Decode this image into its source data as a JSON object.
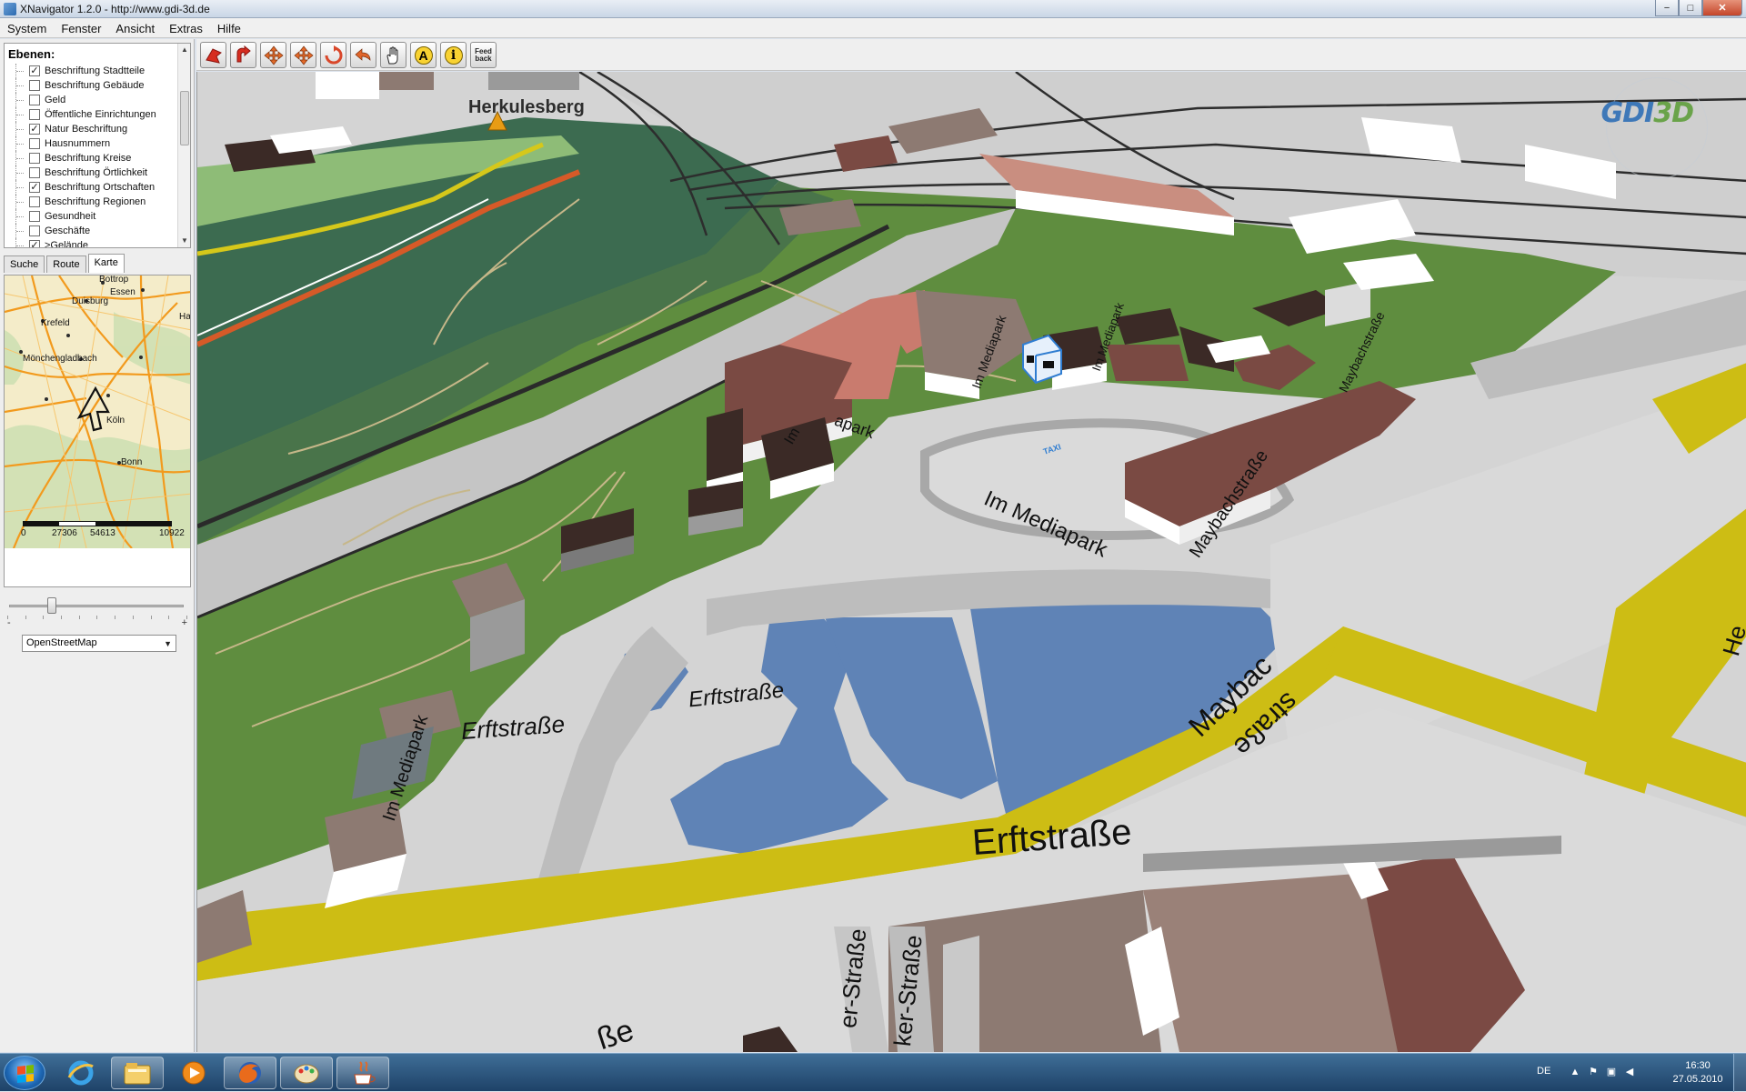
{
  "window": {
    "title": "XNavigator 1.2.0 - http://www.gdi-3d.de",
    "minimize": "−",
    "maximize": "□",
    "close": "✕"
  },
  "menu": [
    "System",
    "Fenster",
    "Ansicht",
    "Extras",
    "Hilfe"
  ],
  "layers": {
    "title": "Ebenen:",
    "items": [
      {
        "label": "Beschriftung Stadtteile",
        "checked": true
      },
      {
        "label": "Beschriftung Gebäude",
        "checked": false
      },
      {
        "label": "Geld",
        "checked": false
      },
      {
        "label": "Öffentliche Einrichtungen",
        "checked": false
      },
      {
        "label": "Natur Beschriftung",
        "checked": true
      },
      {
        "label": "Hausnummern",
        "checked": false
      },
      {
        "label": "Beschriftung Kreise",
        "checked": false
      },
      {
        "label": "Beschriftung Örtlichkeit",
        "checked": false
      },
      {
        "label": "Beschriftung Ortschaften",
        "checked": true
      },
      {
        "label": "Beschriftung Regionen",
        "checked": false
      },
      {
        "label": "Gesundheit",
        "checked": false
      },
      {
        "label": "Geschäfte",
        "checked": false
      },
      {
        "label": ">Gelände",
        "checked": true
      }
    ]
  },
  "tabs": [
    "Suche",
    "Route",
    "Karte"
  ],
  "active_tab": "Karte",
  "minimap": {
    "cities": [
      "Bottrop",
      "Essen",
      "Duisburg",
      "Krefeld",
      "Ha",
      "Mönchengladbach",
      "Köln",
      "Bonn"
    ],
    "scale": [
      "0",
      "27306",
      "54613",
      "10922"
    ]
  },
  "zoom_slider": {
    "minus": "-",
    "plus": "+",
    "value": 0.23
  },
  "map_source": {
    "selected": "OpenStreetMap"
  },
  "toolbar": {
    "tools": [
      "pan-red-icon",
      "tilt-red-icon",
      "move-icon",
      "move-cross-icon",
      "rotate-icon",
      "back-arrow-icon",
      "hand-icon",
      "text-a-icon",
      "info-icon",
      "feedback-icon"
    ],
    "feedback_label": "Feed back",
    "text_label": "A",
    "info_label": "i"
  },
  "viewport": {
    "logo_main": "GDI",
    "logo_accent": "3D",
    "labels": {
      "herkulesberg": "Herkulesberg",
      "erftstrasse_1": "Erftstraße",
      "erftstrasse_2": "Erftstraße",
      "erftstrasse_3": "Erftstraße",
      "im_mediapark_1": "Im Mediapark",
      "im_mediapark_2": "Im Mediapark",
      "im_mediapark_3": "Im Mediapark",
      "im_mediapark_4": "Im",
      "maybach_1": "Maybachstraße",
      "maybach_2": "Maybachstraße",
      "maybach_big_1": "Maybac",
      "maybach_big_2": "straße",
      "ker_strasse_1": "er-Straße",
      "ker_strasse_2": "ker-Straße",
      "apark": "apark",
      "mediapark_small": "Im Mediapark",
      "be": "ße",
      "taxi": "TAXI",
      "he": "He"
    },
    "colors": {
      "grass": "#5e8c3e",
      "water": "#5e83b5",
      "road_yellow": "#cdbd14",
      "road_grey": "#c9c9c9",
      "building_brown": "#7a4a43",
      "building_dark": "#3b2a26"
    }
  },
  "taskbar": {
    "items": [
      "start-orb",
      "ie-icon",
      "explorer-icon",
      "media-player-icon",
      "firefox-icon",
      "paint-icon",
      "java-icon"
    ],
    "lang": "DE",
    "time": "16:30",
    "date": "27.05.2010"
  }
}
